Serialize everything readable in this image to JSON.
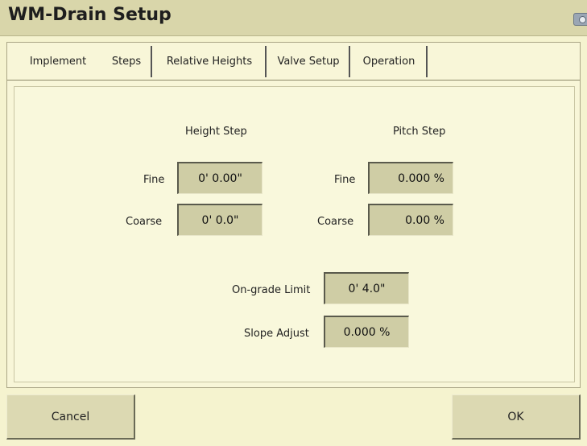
{
  "window": {
    "title": "WM-Drain Setup"
  },
  "tabs": [
    {
      "label": "Implement"
    },
    {
      "label": "Steps"
    },
    {
      "label": "Relative Heights"
    },
    {
      "label": "Valve Setup"
    },
    {
      "label": "Operation"
    }
  ],
  "active_tab": "Steps",
  "steps": {
    "height_step": {
      "heading": "Height Step",
      "fine_label": "Fine",
      "fine_value": "0' 0.00\"",
      "coarse_label": "Coarse",
      "coarse_value": "0' 0.0\""
    },
    "pitch_step": {
      "heading": "Pitch Step",
      "fine_label": "Fine",
      "fine_value": "0.000 %",
      "coarse_label": "Coarse",
      "coarse_value": "0.00 %"
    },
    "on_grade_limit": {
      "label": "On-grade Limit",
      "value": "0' 4.0\""
    },
    "slope_adjust": {
      "label": "Slope Adjust",
      "value": "0.000 %"
    }
  },
  "buttons": {
    "cancel": "Cancel",
    "ok": "OK"
  }
}
